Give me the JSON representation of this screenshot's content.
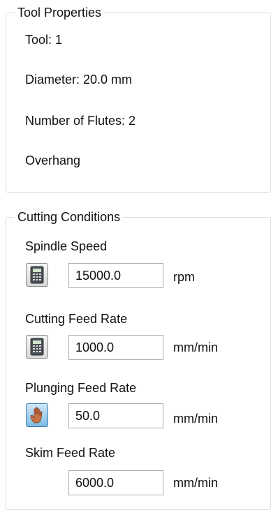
{
  "tool_properties": {
    "title": "Tool Properties",
    "tool": "Tool: 1",
    "diameter": "Diameter: 20.0 mm",
    "flutes": "Number of Flutes: 2",
    "overhang": "Overhang"
  },
  "cutting_conditions": {
    "title": "Cutting Conditions",
    "spindle_speed": {
      "label": "Spindle Speed",
      "value": "15000.0",
      "unit": "rpm",
      "icon": "calculator-icon"
    },
    "cutting_feed_rate": {
      "label": "Cutting Feed Rate",
      "value": "1000.0",
      "unit": "mm/min",
      "icon": "calculator-icon"
    },
    "plunging_feed_rate": {
      "label": "Plunging Feed Rate",
      "value": "50.0",
      "unit": "mm/min",
      "icon": "hand-icon"
    },
    "skim_feed_rate": {
      "label": "Skim Feed Rate",
      "value": "6000.0",
      "unit": "mm/min"
    }
  },
  "colors": {
    "group_border": "#d5dfe5",
    "input_border": "#abadb3",
    "pressed_button": "#7fbde3"
  }
}
